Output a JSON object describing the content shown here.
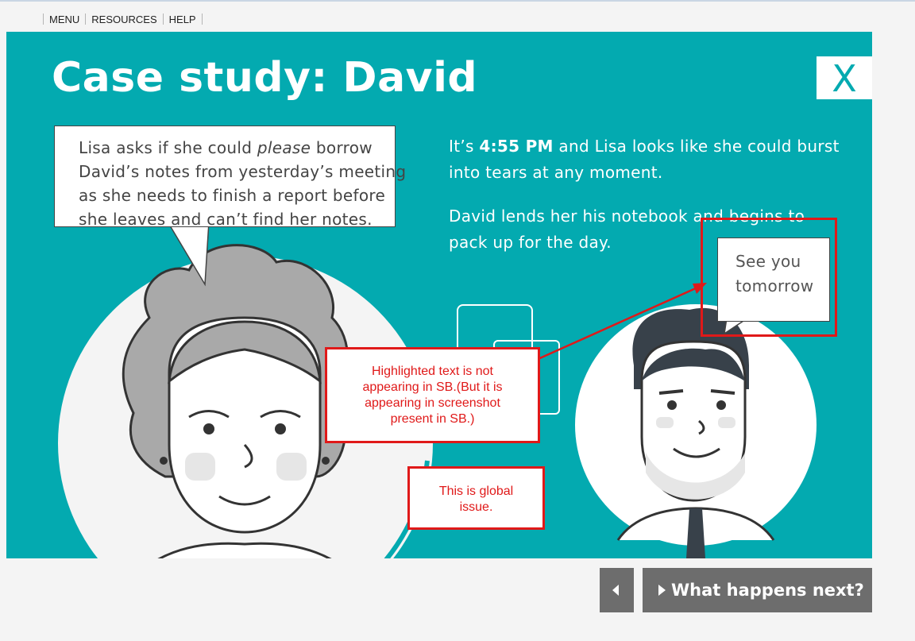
{
  "menu": {
    "items": [
      {
        "label": "MENU"
      },
      {
        "label": "RESOURCES"
      },
      {
        "label": "HELP"
      }
    ]
  },
  "slide": {
    "title": "Case study: David",
    "close_label": "X",
    "lisa_bubble": {
      "line1_pre": "Lisa asks if she could ",
      "line1_em": "please",
      "line1_post": " borrow",
      "line2": "David’s notes from yesterday’s meeting",
      "line3": "as she needs to finish a report before",
      "line4": "she leaves and can’t find her notes."
    },
    "story": {
      "p1_pre": "It’s ",
      "p1_time": "4:55 PM",
      "p1_post": " and Lisa looks like she could burst",
      "p1_line2": "into tears at any moment.",
      "p2_line1": "David lends her his notebook and begins to",
      "p2_line2": "pack up for the day."
    },
    "david_bubble": {
      "line1": "See you",
      "line2": "tomorrow"
    }
  },
  "annotations": {
    "note1": [
      "Highlighted text is not",
      "appearing in SB.(But it is",
      "appearing in screenshot",
      "present in SB.)"
    ],
    "note2": [
      "This is global",
      "issue."
    ]
  },
  "nav": {
    "next_label": "What happens next?"
  },
  "colors": {
    "panel": "#03aab0",
    "annotation": "#e01919",
    "nav_button": "#6d6d6d"
  }
}
